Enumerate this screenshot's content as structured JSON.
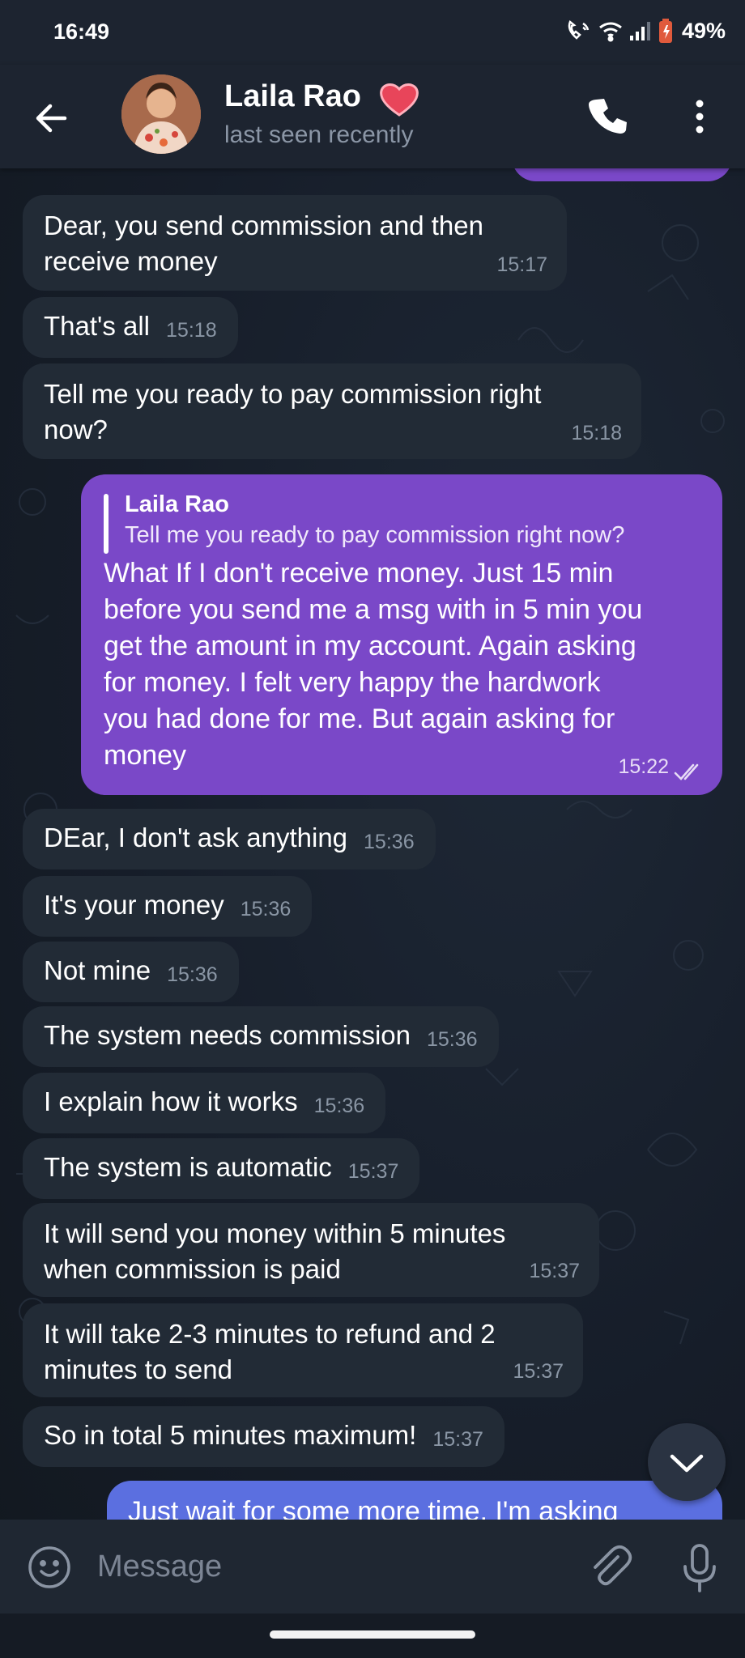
{
  "status_bar": {
    "time": "16:49",
    "battery": "49%"
  },
  "header": {
    "name": "Laila Rao",
    "status": "last seen recently"
  },
  "messages": [
    {
      "text": "Dear, you send commission and then receive money",
      "lines": [
        "Dear, you send commission and then",
        "receive money"
      ],
      "time": "15:17"
    },
    {
      "text": "That's all",
      "time": "15:18"
    },
    {
      "text": "Tell me you ready to pay commission right now?",
      "lines": [
        "Tell me you ready to pay commission right",
        "now?"
      ],
      "time": "15:18"
    },
    {
      "reply_to": {
        "name": "Laila Rao",
        "text": "Tell me you ready to pay commission right now?"
      },
      "text": "What If I don't receive money. Just 15 min before you send me a msg with in 5 min you get the amount in my account. Again asking for money. I felt very happy the hardwork you had done for me. But again asking for money",
      "lines": [
        "What If I don't receive money. Just 15 min",
        "before you send me a msg with in 5 min you",
        "get the amount in my account. Again asking",
        "for money. I felt very happy the hardwork",
        "you had done for me. But again asking for",
        "money"
      ],
      "time": "15:22",
      "read": true
    },
    {
      "text": "DEar, I don't ask anything",
      "time": "15:36"
    },
    {
      "text": "It's your money",
      "time": "15:36"
    },
    {
      "text": "Not mine",
      "time": "15:36"
    },
    {
      "text": "The system needs commission",
      "time": "15:36"
    },
    {
      "text": "I explain how it works",
      "time": "15:36"
    },
    {
      "text": "The system is automatic",
      "time": "15:37"
    },
    {
      "text": "It will send you money within 5 minutes when commission is paid",
      "lines": [
        "It will send you money within 5 minutes",
        "when commission is paid"
      ],
      "time": "15:37"
    },
    {
      "text": "It will take 2-3 minutes to refund and 2 minutes to send",
      "lines": [
        "It will take 2-3 minutes to refund and 2",
        "minutes to send"
      ],
      "time": "15:37"
    },
    {
      "text": "So in total 5 minutes maximum!",
      "time": "15:37"
    },
    {
      "text": "Just wait for some more time. I'm asking"
    }
  ],
  "composer": {
    "placeholder": "Message"
  },
  "icons": {
    "back": "arrow-left-icon",
    "call": "phone-icon",
    "menu": "more-vertical-icon",
    "emoji": "emoji-icon",
    "attach": "paperclip-icon",
    "mic": "microphone-icon",
    "scroll": "chevron-down-icon",
    "heart": "heart-icon"
  },
  "colors": {
    "outgoing_bubble": "#7a48c8",
    "incoming_bubble": "#222b36",
    "background": "#141b27"
  }
}
